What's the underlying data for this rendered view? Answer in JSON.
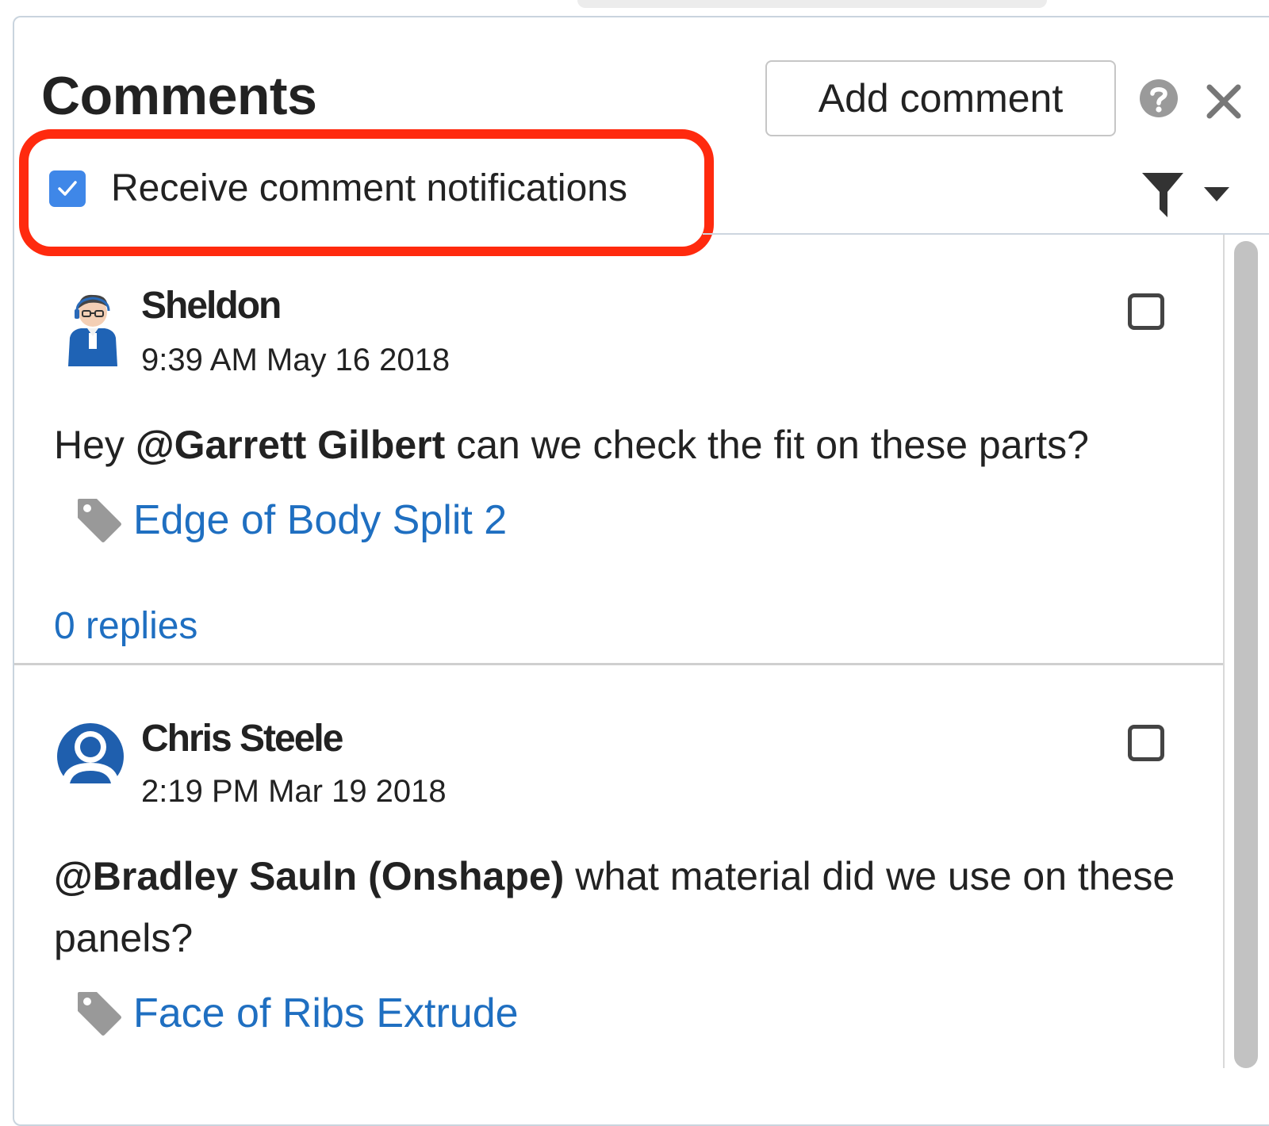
{
  "panel": {
    "title": "Comments",
    "add_comment_label": "Add comment"
  },
  "notifications": {
    "label": "Receive comment notifications",
    "checked": true
  },
  "comments": [
    {
      "author": "Sheldon",
      "timestamp": "9:39 AM May 16 2018",
      "text_before": "Hey ",
      "mention": "@Garrett Gilbert",
      "text_after": "  can we check the fit on these parts?",
      "tag": "Edge of Body Split 2",
      "replies": "0 replies"
    },
    {
      "author": "Chris Steele",
      "timestamp": "2:19 PM Mar 19 2018",
      "text_before": "",
      "mention": "@Bradley Sauln (Onshape)",
      "text_after": " what material did we use on these panels?",
      "tag": "Face of Ribs Extrude"
    }
  ],
  "colors": {
    "accent_blue": "#1f6fc1",
    "checkbox_blue": "#3f87e8",
    "highlight_red": "#ff2a0e"
  },
  "icons": [
    "help-icon",
    "close-icon",
    "filter-icon",
    "chevron-down-icon",
    "tag-icon",
    "checkmark-icon"
  ]
}
